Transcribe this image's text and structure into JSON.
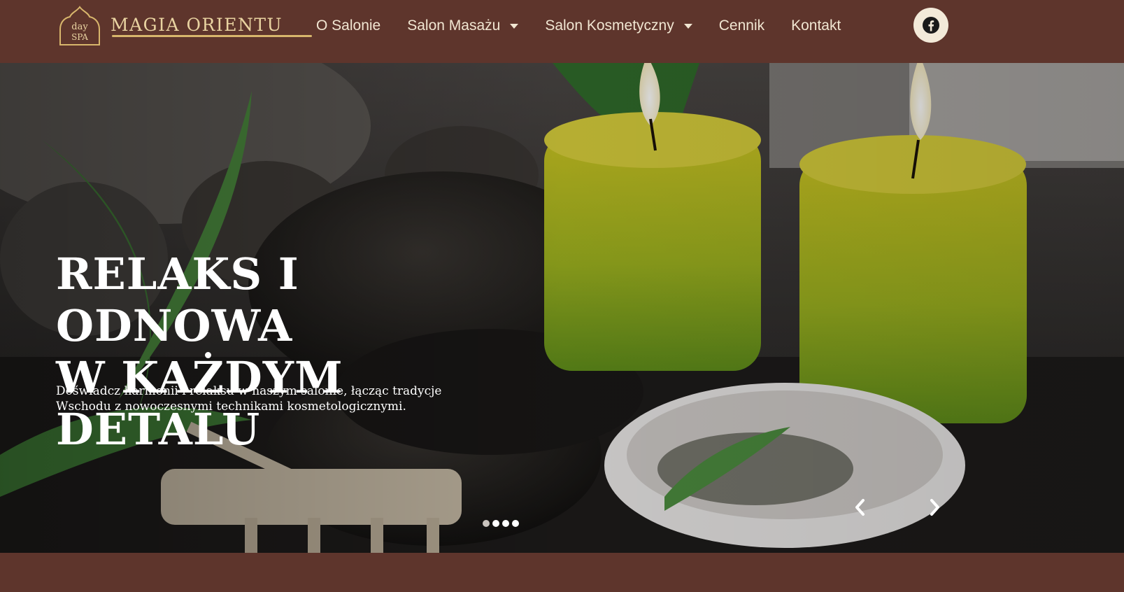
{
  "header": {
    "logo": {
      "badge_line1": "day",
      "badge_line2": "SPA",
      "name": "MAGIA ORIENTU"
    },
    "nav": [
      {
        "label": "O Salonie",
        "has_dropdown": false
      },
      {
        "label": "Salon Masażu",
        "has_dropdown": true
      },
      {
        "label": "Salon Kosmetyczny",
        "has_dropdown": true
      },
      {
        "label": "Cennik",
        "has_dropdown": false
      },
      {
        "label": "Kontakt",
        "has_dropdown": false
      }
    ],
    "social": {
      "icon": "facebook-icon"
    }
  },
  "hero": {
    "title_line1": "RELAKS I ODNOWA",
    "title_line2": "W KAŻDYM DETALU",
    "subtitle_line1": "Doświadcz harmonii i relaksu w naszym salonie, łącząc tradycje",
    "subtitle_line2": "Wschodu z nowoczesnymi technikami kosmetologicznymi.",
    "slider": {
      "slide_count": 4,
      "active_slide": 2,
      "prev_icon": "chevron-left-icon",
      "next_icon": "chevron-right-icon"
    }
  },
  "colors": {
    "header_bg": "#5e352c",
    "nav_text": "#f1e6d2",
    "logo_gold": "#e9d3a1",
    "hero_text": "#ffffff"
  }
}
